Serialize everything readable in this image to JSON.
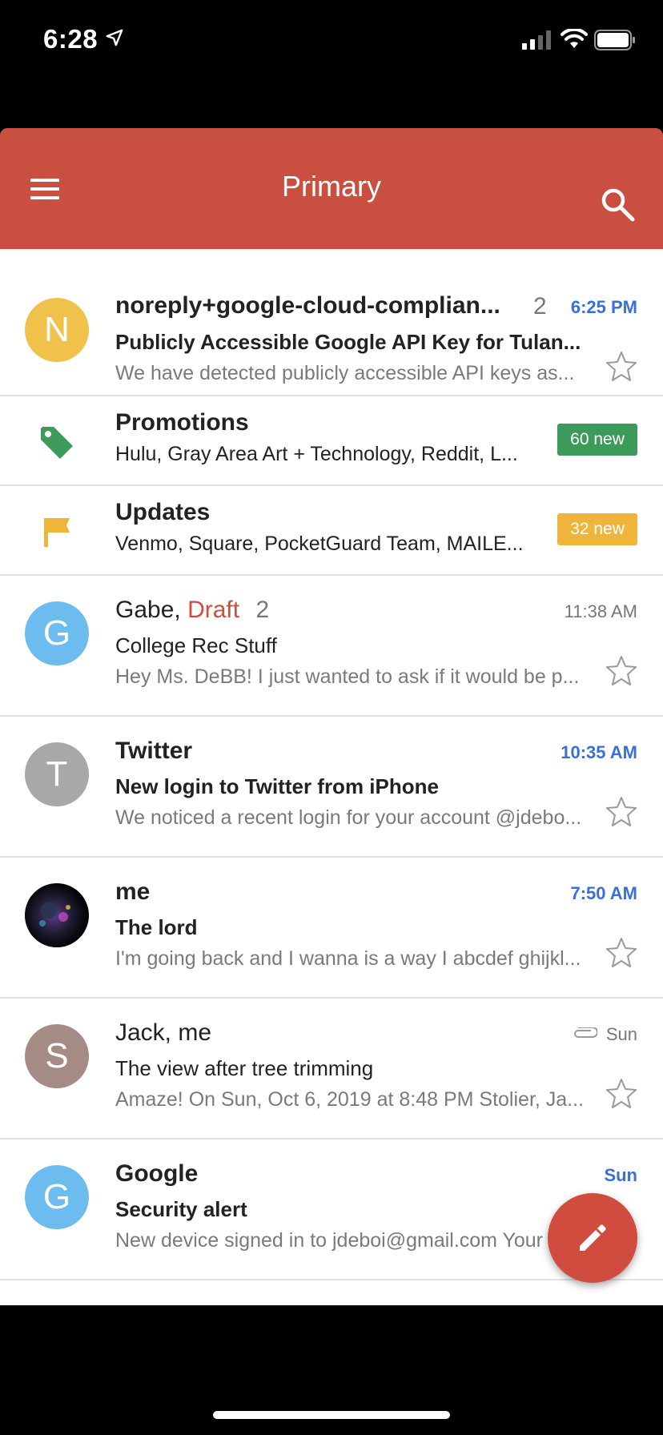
{
  "status_bar": {
    "time": "6:28"
  },
  "toolbar": {
    "title": "Primary"
  },
  "emails": [
    {
      "avatar_letter": "N",
      "avatar_color": "#f0c24b",
      "sender": "noreply+google-cloud-complian...",
      "count": "2",
      "time": "6:25 PM",
      "subject": "Publicly Accessible Google API Key for Tulan...",
      "snippet": "We have detected publicly accessible API keys as..."
    },
    {
      "avatar_letter": "G",
      "avatar_color": "#6cbcf0",
      "sender": "Gabe,",
      "draft": "Draft",
      "count": "2",
      "time": "11:38 AM",
      "subject": "College Rec Stuff",
      "snippet": "Hey Ms. DeBB! I just wanted to ask if it would be p..."
    },
    {
      "avatar_letter": "T",
      "avatar_color": "#a8a8a8",
      "sender": "Twitter",
      "time": "10:35 AM",
      "subject": "New login to Twitter from iPhone",
      "snippet": "We noticed a recent login for your account @jdebo..."
    },
    {
      "sender": "me",
      "time": "7:50 AM",
      "subject": "The lord",
      "snippet": "I'm going back and I wanna is a way I abcdef ghijkl..."
    },
    {
      "avatar_letter": "S",
      "avatar_color": "#a48c84",
      "sender": "Jack, me",
      "time": "Sun",
      "subject": "The view after tree trimming",
      "snippet": "Amaze! On Sun, Oct 6, 2019 at 8:48 PM Stolier, Ja..."
    },
    {
      "avatar_letter": "G",
      "avatar_color": "#6cbcf0",
      "sender": "Google",
      "time": "Sun",
      "subject": "Security alert",
      "snippet": "New device signed in to jdeboi@gmail.com Your G..."
    }
  ],
  "categories": [
    {
      "title": "Promotions",
      "senders": "Hulu, Gray Area Art + Technology, Reddit, L...",
      "badge": "60 new",
      "color": "#3c9a5a"
    },
    {
      "title": "Updates",
      "senders": "Venmo, Square, PocketGuard Team, MAILE...",
      "badge": "32 new",
      "color": "#efb43a"
    }
  ],
  "colors": {
    "toolbar": "#c94f40",
    "unread_time": "#3a6fd8",
    "draft": "#d04c3e",
    "fab": "#d04c3e"
  },
  "icons": {
    "menu": "hamburger-menu-icon",
    "search": "search-icon",
    "star": "star-outline-icon",
    "attachment": "paperclip-icon",
    "compose": "pencil-icon",
    "promotions": "tag-icon",
    "updates": "flag-icon"
  }
}
